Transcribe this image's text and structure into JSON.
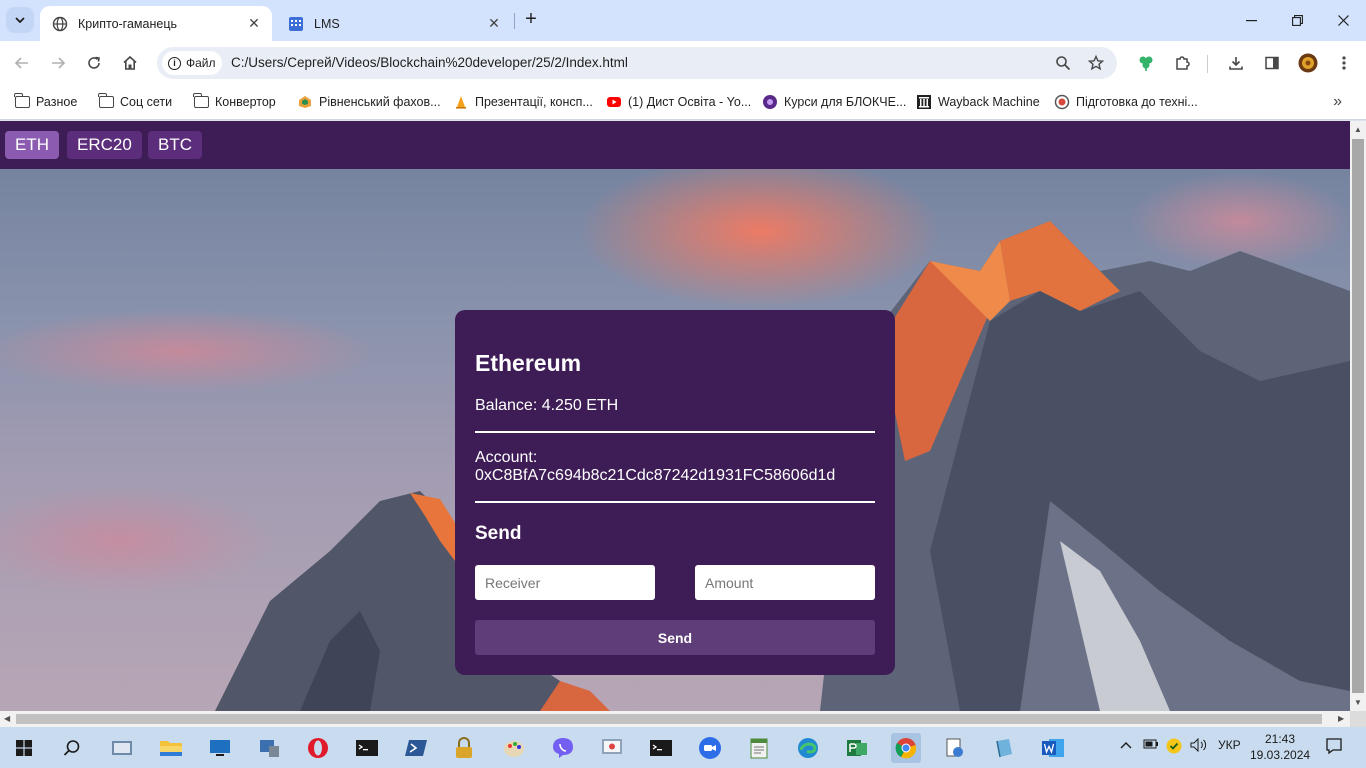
{
  "browser": {
    "tabs": [
      {
        "title": "Крипто-гаманець",
        "active": true
      },
      {
        "title": "LMS",
        "active": false
      }
    ],
    "site_chip": "Файл",
    "url": "C:/Users/Сергей/Videos/Blockchain%20developer/25/2/Index.html",
    "bookmarks": [
      {
        "label": "Разное",
        "icon": "folder-icon"
      },
      {
        "label": "Соц сети",
        "icon": "folder-icon"
      },
      {
        "label": "Конвертор",
        "icon": "folder-icon"
      },
      {
        "label": "Рівненський фахов...",
        "icon": "college-icon"
      },
      {
        "label": "Презентації, консп...",
        "icon": "cone-icon"
      },
      {
        "label": "(1) Дист Освіта - Yo...",
        "icon": "youtube-icon"
      },
      {
        "label": "Курси для БЛОКЧЕ...",
        "icon": "course-icon"
      },
      {
        "label": "Wayback Machine",
        "icon": "archive-icon"
      },
      {
        "label": "Підготовка до техні...",
        "icon": "search-lens-icon"
      }
    ]
  },
  "app": {
    "nav": [
      "ETH",
      "ERC20",
      "BTC"
    ],
    "active_nav": "ETH",
    "colors": {
      "panel": "#3e1c55",
      "active_tab": "#8a5bb0",
      "button": "#5e3d79"
    },
    "wallet": {
      "title": "Ethereum",
      "balance": "Balance: 4.250 ETH",
      "account_label": "Account:",
      "account_address": "0xC8BfA7c694b8c21Cdc87242d1931FC58606d1d",
      "send_title": "Send",
      "receiver_placeholder": "Receiver",
      "amount_placeholder": "Amount",
      "send_button": "Send"
    }
  },
  "taskbar": {
    "language": "УКР",
    "time": "21:43",
    "date": "19.03.2024"
  }
}
